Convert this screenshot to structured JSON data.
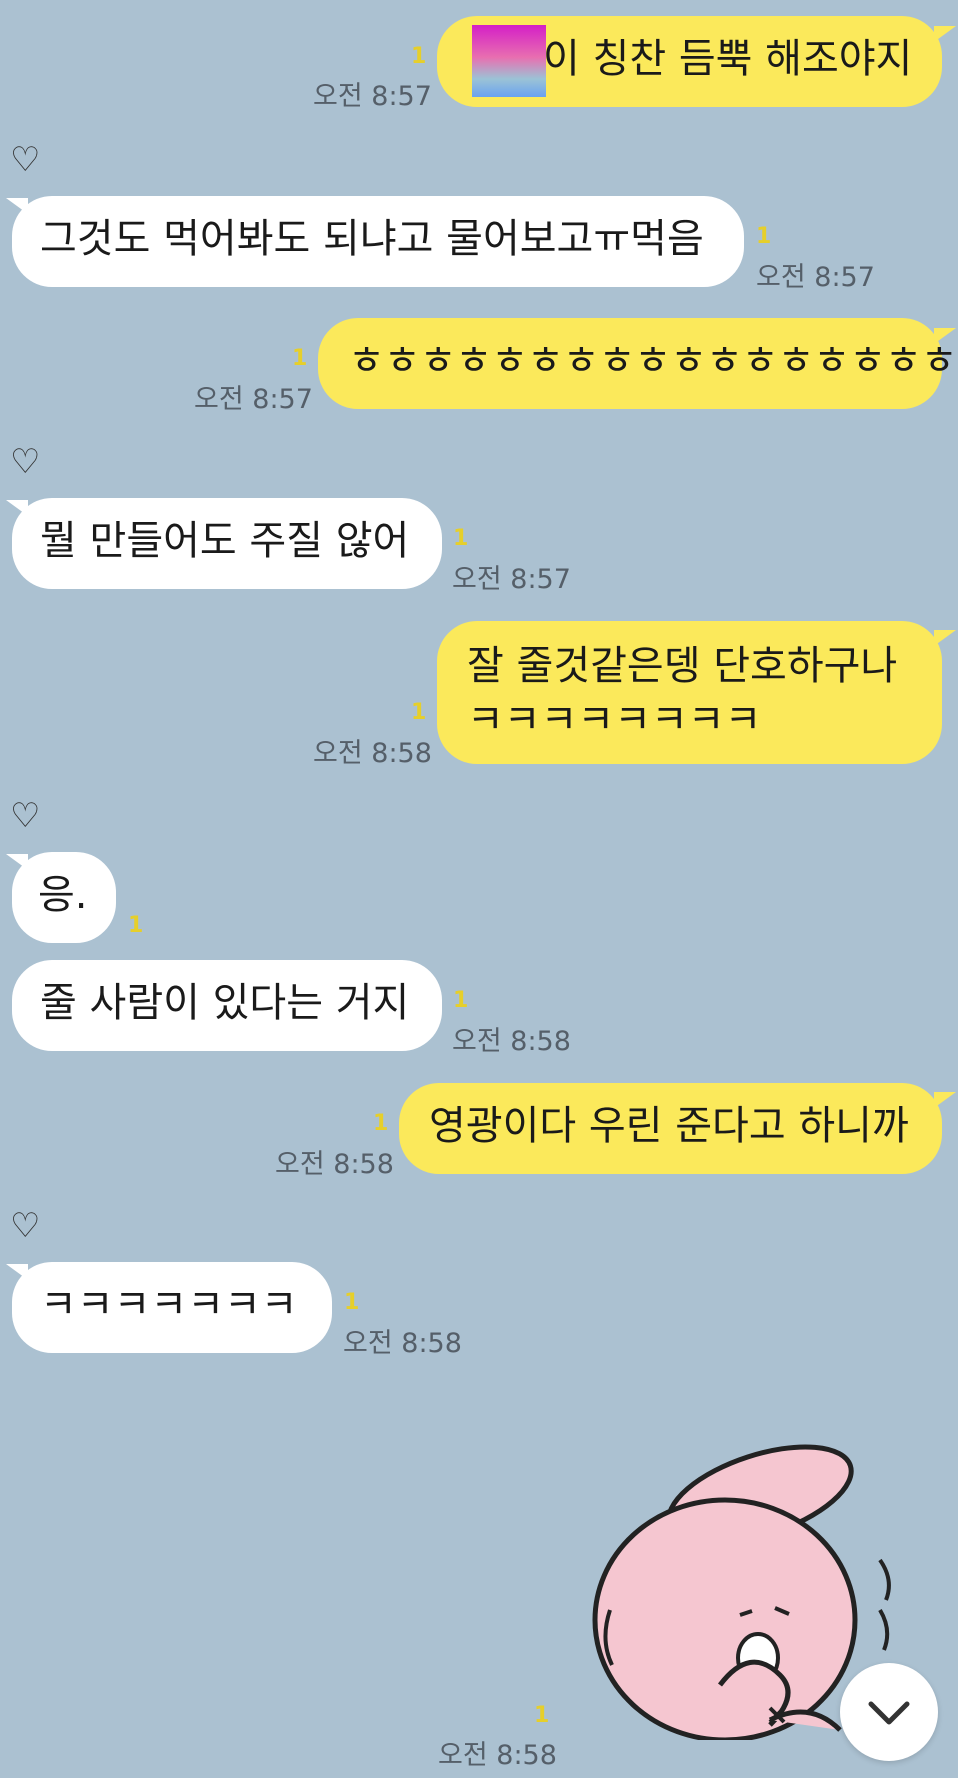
{
  "messages": [
    {
      "side": "me",
      "text": "이 칭찬 듬뿍 해조야지",
      "time": "오전 8:57",
      "unread": "1"
    },
    {
      "side": "you",
      "heart": "♡",
      "text": "그것도 먹어봐도 되냐고 물어보고ㅠ먹음",
      "time": "오전 8:57",
      "unread": "1"
    },
    {
      "side": "me",
      "text": "ㅎㅎㅎㅎㅎㅎㅎㅎㅎㅎㅎㅎㅎㅎㅎㅎㅎ",
      "time": "오전 8:57",
      "unread": "1"
    },
    {
      "side": "you",
      "heart": "♡",
      "text": "뭘 만들어도 주질 않어",
      "time": "오전 8:57",
      "unread": "1"
    },
    {
      "side": "me",
      "line1": "잘 줄것같은뎅 단호하구나",
      "line2": "ㅋㅋㅋㅋㅋㅋㅋㅋ",
      "time": "오전 8:58",
      "unread": "1"
    },
    {
      "side": "you",
      "heart": "♡",
      "text": "응.",
      "unread": "1"
    },
    {
      "side": "you",
      "text": "줄 사람이 있다는 거지",
      "time": "오전 8:58",
      "unread": "1"
    },
    {
      "side": "me",
      "text": "영광이다 우린 준다고 하니까",
      "time": "오전 8:58",
      "unread": "1"
    },
    {
      "side": "you",
      "heart": "♡",
      "text": "ㅋㅋㅋㅋㅋㅋㅋ",
      "time": "오전 8:58",
      "unread": "1"
    },
    {
      "side": "me",
      "type": "sticker",
      "sticker": "pink-rabbit-sticker",
      "time": "오전 8:58",
      "unread": "1"
    }
  ],
  "icons": {
    "scroll_down": "chevron-down-icon",
    "reaction": "heart-outline-icon"
  },
  "colors": {
    "background": "#abc1d1",
    "my_bubble": "#fbe95b",
    "their_bubble": "#ffffff",
    "unread": "#e6cf2a"
  }
}
